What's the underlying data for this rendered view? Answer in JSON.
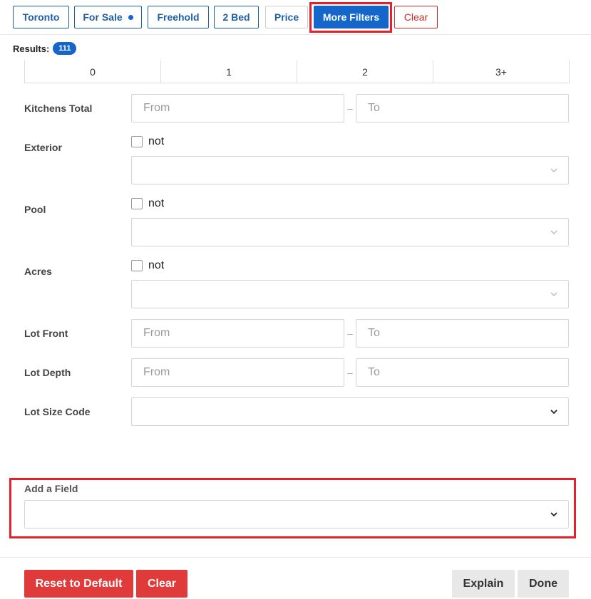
{
  "filter_chips": {
    "toronto": "Toronto",
    "for_sale": "For Sale",
    "freehold": "Freehold",
    "bed": "2 Bed",
    "price": "Price",
    "more_filters": "More Filters",
    "clear": "Clear"
  },
  "results": {
    "label": "Results:",
    "count": "111"
  },
  "segment_options": [
    "0",
    "1",
    "2",
    "3+"
  ],
  "fields": {
    "kitchens_total": {
      "label": "Kitchens Total",
      "from_placeholder": "From",
      "to_placeholder": "To"
    },
    "exterior": {
      "label": "Exterior",
      "not_label": "not"
    },
    "pool": {
      "label": "Pool",
      "not_label": "not"
    },
    "acres": {
      "label": "Acres",
      "not_label": "not"
    },
    "lot_front": {
      "label": "Lot Front",
      "from_placeholder": "From",
      "to_placeholder": "To"
    },
    "lot_depth": {
      "label": "Lot Depth",
      "from_placeholder": "From",
      "to_placeholder": "To"
    },
    "lot_size_code": {
      "label": "Lot Size Code"
    },
    "range_separator": "–"
  },
  "add_field": {
    "label": "Add a Field"
  },
  "footer": {
    "reset": "Reset to Default",
    "clear": "Clear",
    "explain": "Explain",
    "done": "Done"
  },
  "colors": {
    "accent": "#1466c9",
    "danger": "#e03a3a",
    "highlight": "#e3202c"
  }
}
